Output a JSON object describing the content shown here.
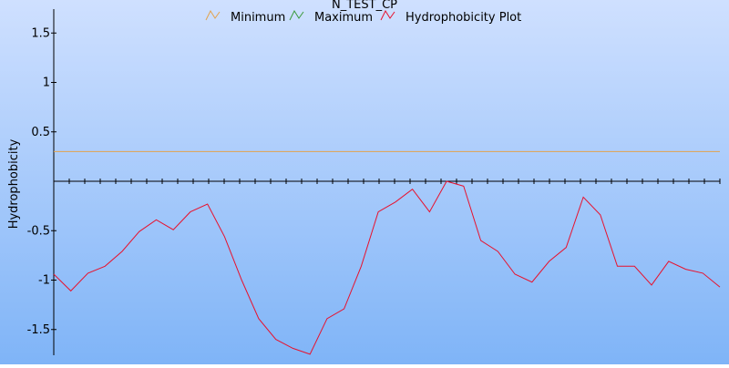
{
  "chart_data": {
    "type": "line",
    "title": "N_TEST_CP",
    "xlabel": "",
    "ylabel": "Hydrophobicity",
    "ylim": [
      -1.75,
      1.7
    ],
    "yticks": [
      1.5,
      1,
      0.5,
      -0.5,
      -1,
      -1.5
    ],
    "ytick_labels": [
      "1.5",
      "1",
      "0.5",
      "-0.5",
      "-1",
      "-1.5"
    ],
    "x_tick_count": 44,
    "legend_position": "top",
    "grid": false,
    "series": [
      {
        "name": "Minimum",
        "color": "#e3a24c",
        "kind": "constant",
        "values": [
          0.3,
          0.3
        ]
      },
      {
        "name": "Maximum",
        "color": "#3a9a3a",
        "kind": "constant",
        "values": []
      },
      {
        "name": "Hydrophobicity Plot",
        "color": "#e8112d",
        "kind": "profile",
        "values": [
          -0.94,
          -1.11,
          -0.93,
          -0.86,
          -0.71,
          -0.51,
          -0.39,
          -0.49,
          -0.31,
          -0.23,
          -0.56,
          -1.0,
          -1.39,
          -1.6,
          -1.69,
          -1.75,
          -1.39,
          -1.29,
          -0.86,
          -0.31,
          -0.21,
          -0.08,
          -0.31,
          0.0,
          -0.05,
          -0.6,
          -0.71,
          -0.94,
          -1.02,
          -0.81,
          -0.67,
          -0.16,
          -0.34,
          -0.86,
          -0.86,
          -1.05,
          -0.81,
          -0.89,
          -0.93,
          -1.07
        ]
      }
    ]
  }
}
